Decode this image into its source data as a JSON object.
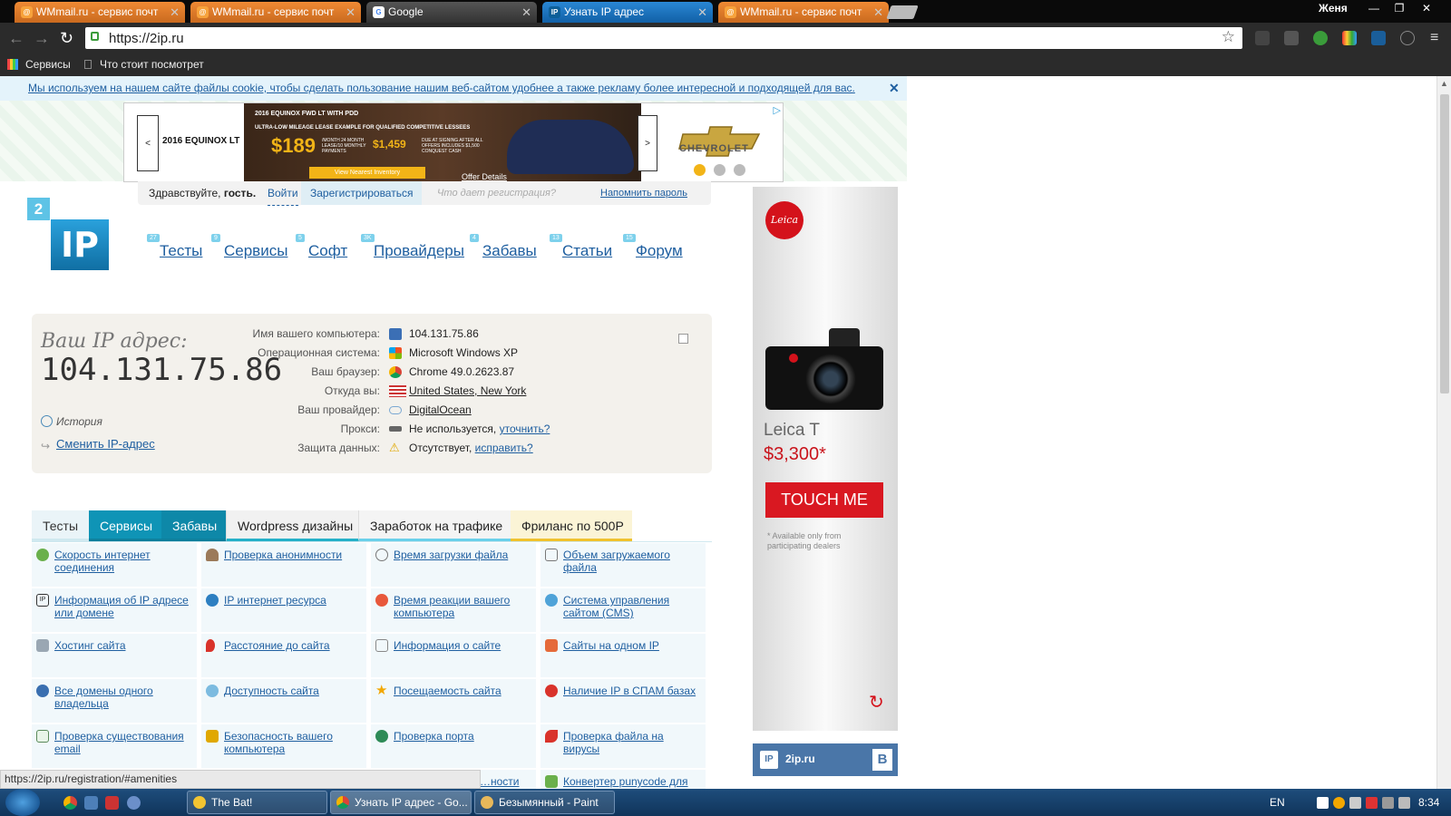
{
  "browser": {
    "tabs": [
      {
        "label": "WMmail.ru - сервис почт",
        "icon": "wmmail-icon",
        "active": false
      },
      {
        "label": "WMmail.ru - сервис почт",
        "icon": "wmmail-icon",
        "active": false
      },
      {
        "label": "Google",
        "icon": "google-icon",
        "active": false
      },
      {
        "label": "Узнать IP адрес",
        "icon": "ip-icon",
        "active": true
      },
      {
        "label": "WMmail.ru - сервис почт",
        "icon": "wmmail-icon",
        "active": false
      }
    ],
    "user": "Женя",
    "url": "https://2ip.ru",
    "bookmarks": {
      "apps": "Сервисы",
      "item1": "Что стоит посмотрет"
    },
    "status_url": "https://2ip.ru/registration/#amenities"
  },
  "cookie_notice": "Мы используем на нашем сайте файлы cookie, чтобы сделать пользование нашим веб-сайтом удобнее а также рекламу более интересной и подходящей для вас.",
  "banner_ad": {
    "model": "2016 EQUINOX LT",
    "line1": "2016 EQUINOX FWD LT WITH PDD",
    "line2": "ULTRA-LOW MILEAGE LEASE EXAMPLE FOR QUALIFIED COMPETITIVE LESSEES",
    "price": "$189",
    "price_note": "/MONTH 24 MONTH LEASE/10 MONTHLY PAYMENTS",
    "due": "$1,459",
    "due_note": "DUE AT SIGNING AFTER ALL OFFERS INCLUDES $1,500 CONQUEST CASH",
    "cta": "View Nearest Inventory",
    "offer": "Offer Details",
    "brand": "CHEVROLET",
    "prev": "<",
    "next": ">"
  },
  "userbar": {
    "greet_prefix": "Здравствуйте,",
    "greet_name": "гость.",
    "login": "Войти",
    "register": "Зарегистрироваться",
    "register_why": "Что дает регистрация?",
    "remind": "Напомнить пароль"
  },
  "logo": {
    "num": "2",
    "text": "IP"
  },
  "nav": [
    {
      "label": "Тесты",
      "badge": "27"
    },
    {
      "label": "Сервисы",
      "badge": "9"
    },
    {
      "label": "Софт",
      "badge": "5"
    },
    {
      "label": "Провайдеры",
      "badge": "3K"
    },
    {
      "label": "Забавы",
      "badge": "4"
    },
    {
      "label": "Статьи",
      "badge": "13"
    },
    {
      "label": "Форум",
      "badge": "15"
    }
  ],
  "ipinfo": {
    "label": "Ваш IP адрес:",
    "ip": "104.131.75.86",
    "history": "История",
    "change": "Сменить IP-адрес",
    "rows": [
      {
        "label": "Имя вашего компьютера:",
        "value": "104.131.75.86",
        "link": "",
        "icon": "computer-icon"
      },
      {
        "label": "Операционная система:",
        "value": "Microsoft Windows XP",
        "link": "",
        "icon": "windows-icon"
      },
      {
        "label": "Ваш браузер:",
        "value": "Chrome 49.0.2623.87",
        "link": "",
        "icon": "chrome-icon"
      },
      {
        "label": "Откуда вы:",
        "value": "",
        "link": "United States, New York",
        "icon": "us-flag-icon"
      },
      {
        "label": "Ваш провайдер:",
        "value": "",
        "link": "DigitalOcean",
        "icon": "cloud-icon"
      },
      {
        "label": "Прокси:",
        "value": "Не используется,",
        "link": "уточнить?",
        "icon": "spy-icon"
      },
      {
        "label": "Защита данных:",
        "value": "Отсутствует,",
        "link": "исправить?",
        "icon": "warning-icon"
      }
    ]
  },
  "section_tabs": [
    "Тесты",
    "Сервисы",
    "Забавы",
    "Wordpress дизайны",
    "Заработок на трафике",
    "Фриланс по 500Р"
  ],
  "services": [
    [
      "Скорость интернет соединения",
      "Проверка анонимности",
      "Время загрузки файла",
      "Объем загружаемого файла"
    ],
    [
      "Информация об IP адресе или домене",
      "IP интернет ресурса",
      "Время реакции вашего компьютера",
      "Система управления сайтом (CMS)"
    ],
    [
      "Хостинг сайта",
      "Расстояние до сайта",
      "Информация о сайте",
      "Сайты на одном IP"
    ],
    [
      "Все домены одного владельца",
      "Доступность сайта",
      "Посещаемость сайта",
      "Наличие IP в СПАМ базах"
    ],
    [
      "Проверка существования email",
      "Безопасность вашего компьютера",
      "Проверка порта",
      "Проверка файла на вирусы"
    ],
    [
      "",
      "",
      "…ности",
      "Конвертер punycode для"
    ]
  ],
  "side_ad": {
    "logo": "Leica",
    "model": "Leica T",
    "price": "$3,300",
    "asterisk": "*",
    "button": "TOUCH ME",
    "note": "* Available only from participating dealers"
  },
  "vk_widget": {
    "logo": "IP",
    "name": "2ip.ru",
    "button": "B"
  },
  "taskbar": {
    "tasks": [
      "The Bat!",
      "Узнать IP адрес - Go...",
      "Безымянный - Paint"
    ],
    "lang": "EN",
    "time": "8:34"
  },
  "colors": {
    "accent": "#1a86c0",
    "teal_tab": "#0f94b6",
    "leica_red": "#d91821",
    "link": "#1f5fa0"
  }
}
